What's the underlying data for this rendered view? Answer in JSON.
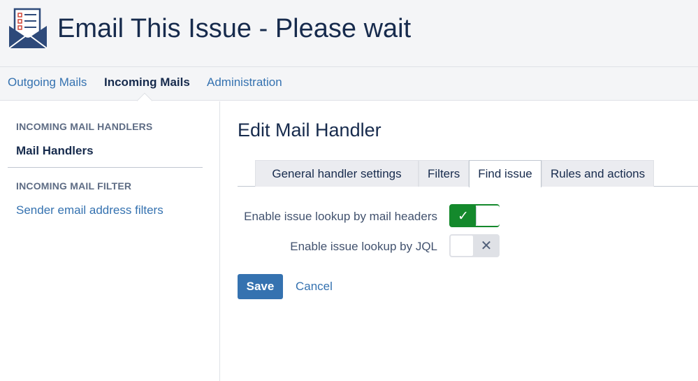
{
  "header": {
    "title": "Email This Issue - Please wait",
    "logo_icon": "envelope-checklist-icon"
  },
  "nav": {
    "items": [
      {
        "label": "Outgoing Mails",
        "active": false
      },
      {
        "label": "Incoming Mails",
        "active": true
      },
      {
        "label": "Administration",
        "active": false
      }
    ]
  },
  "sidebar": {
    "sections": [
      {
        "heading": "INCOMING MAIL HANDLERS",
        "items": [
          {
            "label": "Mail Handlers",
            "active": true
          }
        ]
      },
      {
        "heading": "INCOMING MAIL FILTER",
        "items": [
          {
            "label": "Sender email address filters",
            "active": false
          }
        ]
      }
    ]
  },
  "main": {
    "title": "Edit Mail Handler",
    "tabs": [
      {
        "label": "General handler settings",
        "active": false
      },
      {
        "label": "Filters",
        "active": false
      },
      {
        "label": "Find issue",
        "active": true
      },
      {
        "label": "Rules and actions",
        "active": false
      }
    ],
    "fields": [
      {
        "label": "Enable issue lookup by mail headers",
        "enabled": true,
        "glyph": "✓"
      },
      {
        "label": "Enable issue lookup by JQL",
        "enabled": false,
        "glyph": "✕"
      }
    ],
    "save_label": "Save",
    "cancel_label": "Cancel"
  },
  "colors": {
    "primary": "#3572b0",
    "toggle_on": "#14892c",
    "header_bg": "#f4f5f7",
    "text": "#172b4d"
  }
}
